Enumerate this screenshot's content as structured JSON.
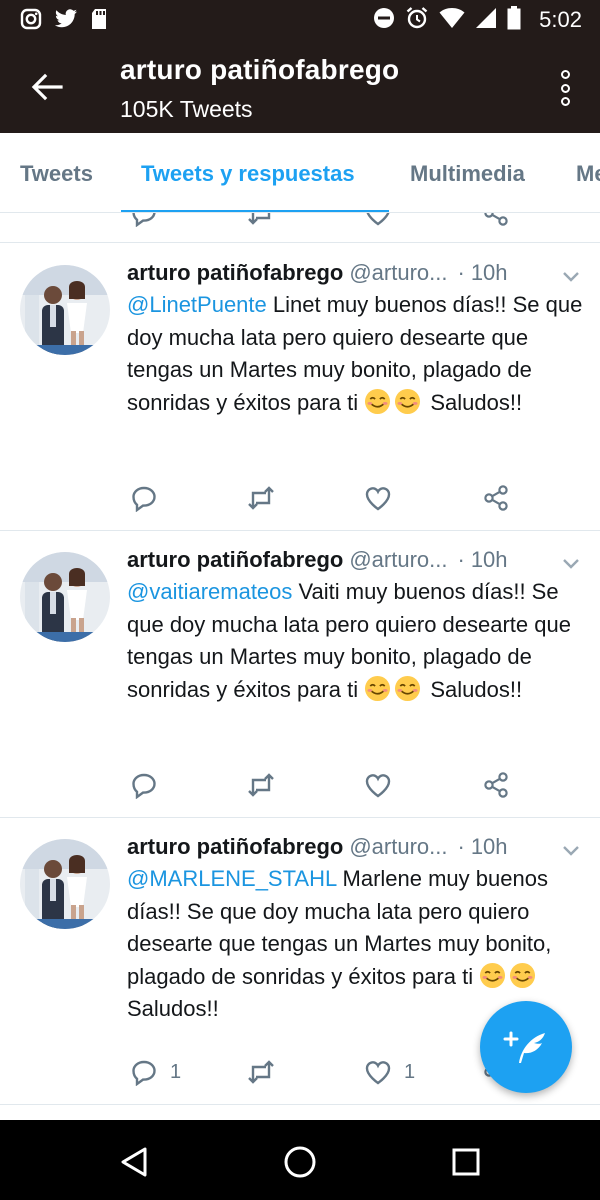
{
  "status_bar": {
    "time": "5:02",
    "left_icons": [
      "instagram-icon",
      "twitter-icon",
      "sd-card-icon"
    ],
    "right_icons": [
      "do-not-disturb-icon",
      "alarm-icon",
      "wifi-icon",
      "signal-icon",
      "battery-icon"
    ]
  },
  "app_bar": {
    "title": "arturo patiñofabrego",
    "subtitle": "105K Tweets",
    "back_icon": "back-arrow-icon",
    "menu_icon": "overflow-menu-icon"
  },
  "tabs": [
    {
      "label": "Tweets",
      "active": false
    },
    {
      "label": "Tweets y respuestas",
      "active": true
    },
    {
      "label": "Multimedia",
      "active": false
    },
    {
      "label": "Me",
      "active": false
    }
  ],
  "tweets": [
    {
      "name": "arturo patiñofabrego",
      "handle": "@arturo...",
      "dot": "·",
      "time": "10h",
      "mention": "@LinetPuente",
      "text": " Linet muy buenos días!! Se que doy mucha lata pero quiero desearte que tengas un Martes muy bonito, plagado de sonridas y éxitos para ti ",
      "emoji": [
        "smiling-face-emoji",
        "smiling-face-emoji"
      ],
      "tail": " Saludos!!",
      "reply_count": "",
      "retweet_count": "",
      "like_count": ""
    },
    {
      "name": "arturo patiñofabrego",
      "handle": "@arturo...",
      "dot": "·",
      "time": "10h",
      "mention": "@vaitiaremateos",
      "text": " Vaiti muy buenos días!! Se que doy mucha lata pero quiero desearte que tengas un Martes muy bonito, plagado de sonridas y éxitos para ti ",
      "emoji": [
        "smiling-face-emoji",
        "smiling-face-emoji"
      ],
      "tail": " Saludos!!",
      "reply_count": "",
      "retweet_count": "",
      "like_count": ""
    },
    {
      "name": "arturo patiñofabrego",
      "handle": "@arturo...",
      "dot": "·",
      "time": "10h",
      "mention": "@MARLENE_STAHL",
      "text": " Marlene muy buenos días!! Se que doy mucha lata pero quiero desearte que tengas un Martes muy bonito, plagado de sonridas y éxitos para ti ",
      "emoji": [
        "smiling-face-emoji",
        "smiling-face-emoji"
      ],
      "tail": " Saludos!!",
      "reply_count": "1",
      "retweet_count": "",
      "like_count": "1"
    }
  ],
  "fab": {
    "icon": "compose-tweet-icon"
  },
  "nav_bar": {
    "icons": [
      "nav-back-icon",
      "nav-home-icon",
      "nav-recents-icon"
    ]
  },
  "colors": {
    "header_bg": "#231b19",
    "accent": "#1da1f2",
    "mention": "#1b95e0",
    "secondary_text": "#657786",
    "divider": "#e1e8ed"
  }
}
